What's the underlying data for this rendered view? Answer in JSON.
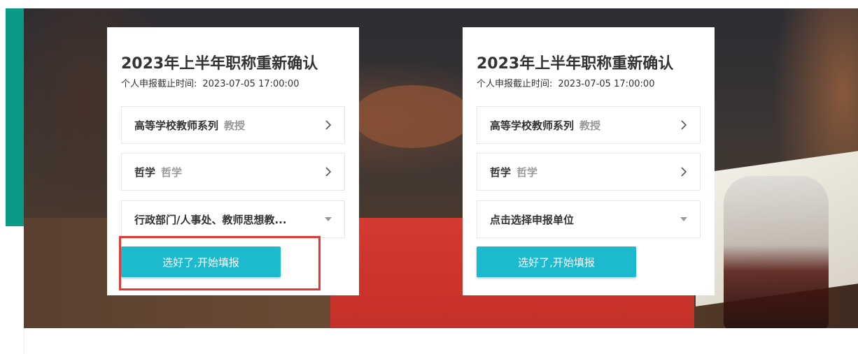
{
  "accent_color": "#0a9a86",
  "button_color": "#1db9cf",
  "highlight_color": "#e53935",
  "cards": [
    {
      "title": "2023年上半年职称重新确认",
      "deadline_label": "个人申报截止时间:",
      "deadline_value": "2023-07-05 17:00:00",
      "series": {
        "main": "高等学校教师系列",
        "sub": "教授"
      },
      "discipline": {
        "main": "哲学",
        "sub": "哲学"
      },
      "unit": {
        "value": "行政部门/人事处、教师思想教..."
      },
      "start_label": "选好了,开始填报"
    },
    {
      "title": "2023年上半年职称重新确认",
      "deadline_label": "个人申报截止时间:",
      "deadline_value": "2023-07-05 17:00:00",
      "series": {
        "main": "高等学校教师系列",
        "sub": "教授"
      },
      "discipline": {
        "main": "哲学",
        "sub": "哲学"
      },
      "unit": {
        "value": "点击选择申报单位"
      },
      "start_label": "选好了,开始填报"
    }
  ]
}
